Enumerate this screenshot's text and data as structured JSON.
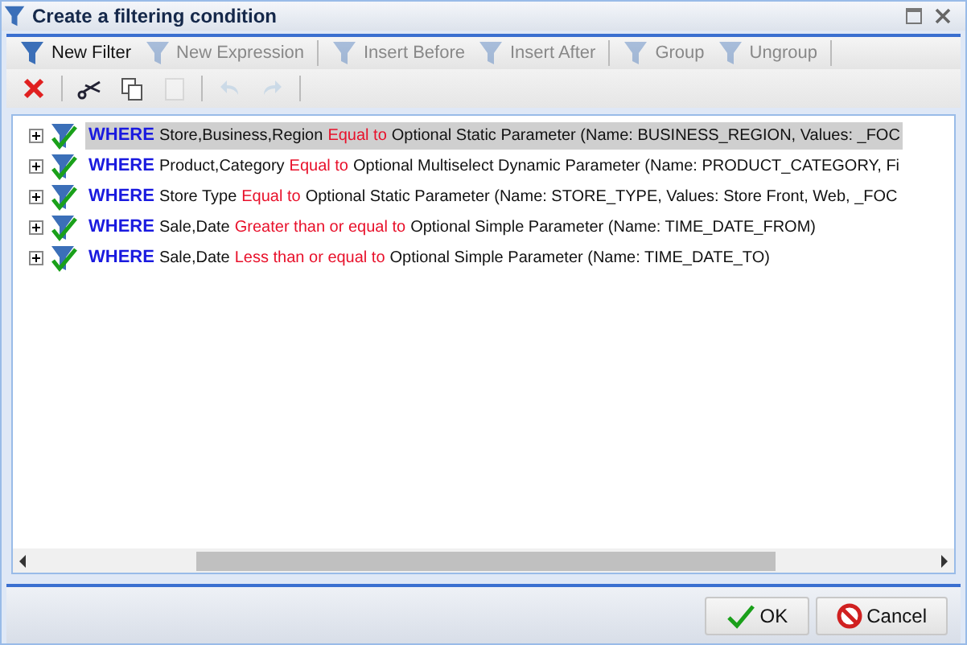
{
  "window": {
    "title": "Create a filtering condition"
  },
  "toolbar": [
    {
      "label": "New Filter",
      "disabled": false
    },
    {
      "label": "New Expression",
      "disabled": true
    },
    {
      "label": "Insert Before",
      "disabled": true
    },
    {
      "label": "Insert After",
      "disabled": true
    },
    {
      "label": "Group",
      "disabled": true
    },
    {
      "label": "Ungroup",
      "disabled": true
    }
  ],
  "edit_toolbar": [
    {
      "kind": "delete",
      "disabled": false
    },
    {
      "kind": "cut",
      "disabled": false
    },
    {
      "kind": "copy",
      "disabled": false
    },
    {
      "kind": "paste",
      "disabled": true
    },
    {
      "kind": "undo",
      "disabled": true
    },
    {
      "kind": "redo",
      "disabled": true
    }
  ],
  "conditions": [
    {
      "keyword": "WHERE",
      "field": "Store,Business,Region",
      "operator": "Equal to",
      "value": "Optional Static Parameter (Name: BUSINESS_REGION, Values: _FOC",
      "selected": true,
      "expanded": false
    },
    {
      "keyword": "WHERE",
      "field": "Product,Category",
      "operator": "Equal to",
      "value": "Optional Multiselect Dynamic Parameter (Name: PRODUCT_CATEGORY, Fi",
      "selected": false,
      "expanded": false
    },
    {
      "keyword": "WHERE",
      "field": "Store Type",
      "operator": "Equal to",
      "value": "Optional Static Parameter (Name: STORE_TYPE, Values: Store Front, Web, _FOC",
      "selected": false,
      "expanded": false
    },
    {
      "keyword": "WHERE",
      "field": "Sale,Date",
      "operator": "Greater than or equal to",
      "value": "Optional Simple Parameter (Name: TIME_DATE_FROM)",
      "selected": false,
      "expanded": false
    },
    {
      "keyword": "WHERE",
      "field": "Sale,Date",
      "operator": "Less than or equal to",
      "value": "Optional Simple Parameter (Name: TIME_DATE_TO)",
      "selected": false,
      "expanded": false
    }
  ],
  "buttons": [
    {
      "kind": "ok",
      "label": "OK"
    },
    {
      "kind": "cancel",
      "label": "Cancel"
    }
  ]
}
